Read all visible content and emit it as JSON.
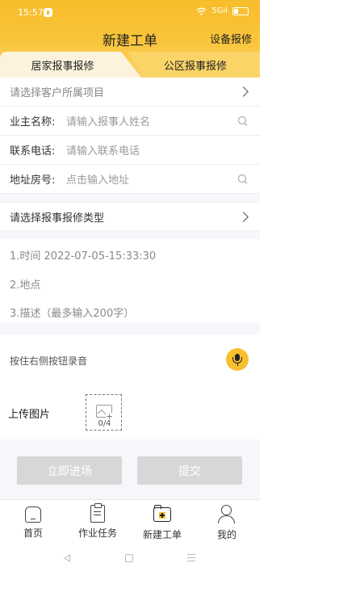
{
  "status_bar": {
    "time": "15:57",
    "signal": "5Gıl"
  },
  "header": {
    "title": "新建工单",
    "device_report": "设备报修"
  },
  "tabs": [
    {
      "label": "居家报事报修",
      "active": true
    },
    {
      "label": "公区报事报修",
      "active": false
    }
  ],
  "form": {
    "project_placeholder": "请选择客户所属项目",
    "owner_label": "业主名称:",
    "owner_placeholder": "请输入报事人姓名",
    "phone_label": "联系电话:",
    "phone_placeholder": "请输入联系电话",
    "address_label": "地址房号:",
    "address_placeholder": "点击输入地址",
    "type_placeholder": "请选择报事报修类型"
  },
  "description": {
    "line1": "1.时间 2022-07-05-15:33:30",
    "line2": "2.地点",
    "line3": "3.描述（最多输入200字）"
  },
  "voice": {
    "hint": "按住右侧按钮录音",
    "icon": "microphone-icon"
  },
  "upload": {
    "label": "上传图片",
    "count": "0/4",
    "icon": "image-add-icon"
  },
  "actions": {
    "enter_label": "立即进场",
    "submit_label": "提交",
    "disabled_color": "#d7d7d7"
  },
  "bottom_nav": [
    {
      "label": "首页",
      "icon": "home-icon"
    },
    {
      "label": "作业任务",
      "icon": "clipboard-icon"
    },
    {
      "label": "新建工单",
      "icon": "folder-add-icon",
      "active": true
    },
    {
      "label": "我的",
      "icon": "user-icon"
    }
  ],
  "colors": {
    "brand": "#f9bf2c",
    "tab_inactive": "#fdf3dc"
  }
}
